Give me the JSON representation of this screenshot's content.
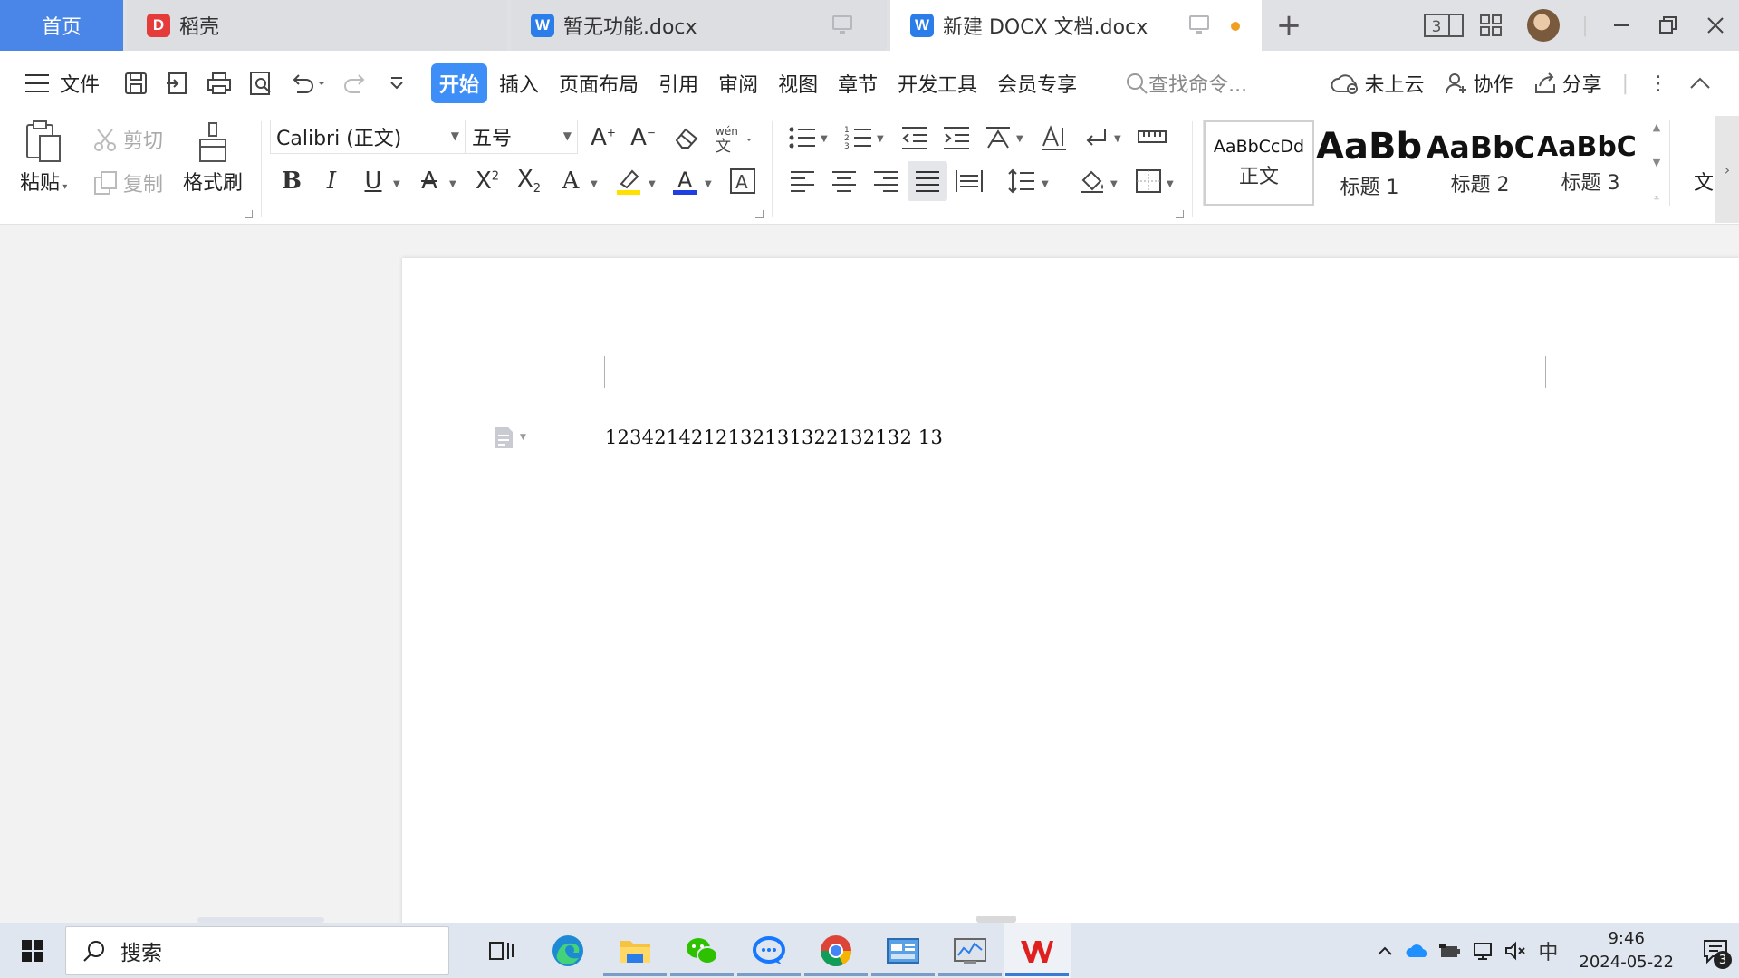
{
  "tabs": {
    "home": "首页",
    "items": [
      {
        "label": "稻壳",
        "icon": "daoke-logo-icon"
      },
      {
        "label": "暂无功能.docx",
        "icon": "wps-writer-icon"
      },
      {
        "label": "新建 DOCX 文档.docx",
        "icon": "wps-writer-icon"
      }
    ],
    "layout_badge": "3"
  },
  "menu": {
    "file": "文件",
    "tabs": [
      "开始",
      "插入",
      "页面布局",
      "引用",
      "审阅",
      "视图",
      "章节",
      "开发工具",
      "会员专享"
    ],
    "search_placeholder": "查找命令...",
    "cloud": "未上云",
    "collab": "协作",
    "share": "分享"
  },
  "ribbon": {
    "paste": "粘贴",
    "cut": "剪切",
    "copy": "复制",
    "format_painter": "格式刷",
    "font_name": "Calibri (正文)",
    "font_size": "五号",
    "styles": [
      {
        "preview": "AaBbCcDd",
        "name": "正文"
      },
      {
        "preview": "AaBb",
        "name": "标题 1"
      },
      {
        "preview": "AaBbC",
        "name": "标题 2"
      },
      {
        "preview": "AaBbC",
        "name": "标题 3"
      }
    ],
    "more": "文"
  },
  "document": {
    "text": "1234214212132131322132132 13"
  },
  "taskbar": {
    "search": "搜索",
    "ime": "中",
    "time": "9:46",
    "date": "2024-05-22",
    "notifications": "3"
  },
  "colors": {
    "accent": "#3e8ef7",
    "home_tab": "#4a86e8",
    "wps_red": "#e0201e",
    "highlight": "#ffe000",
    "font_color": "#1f3fe0"
  }
}
